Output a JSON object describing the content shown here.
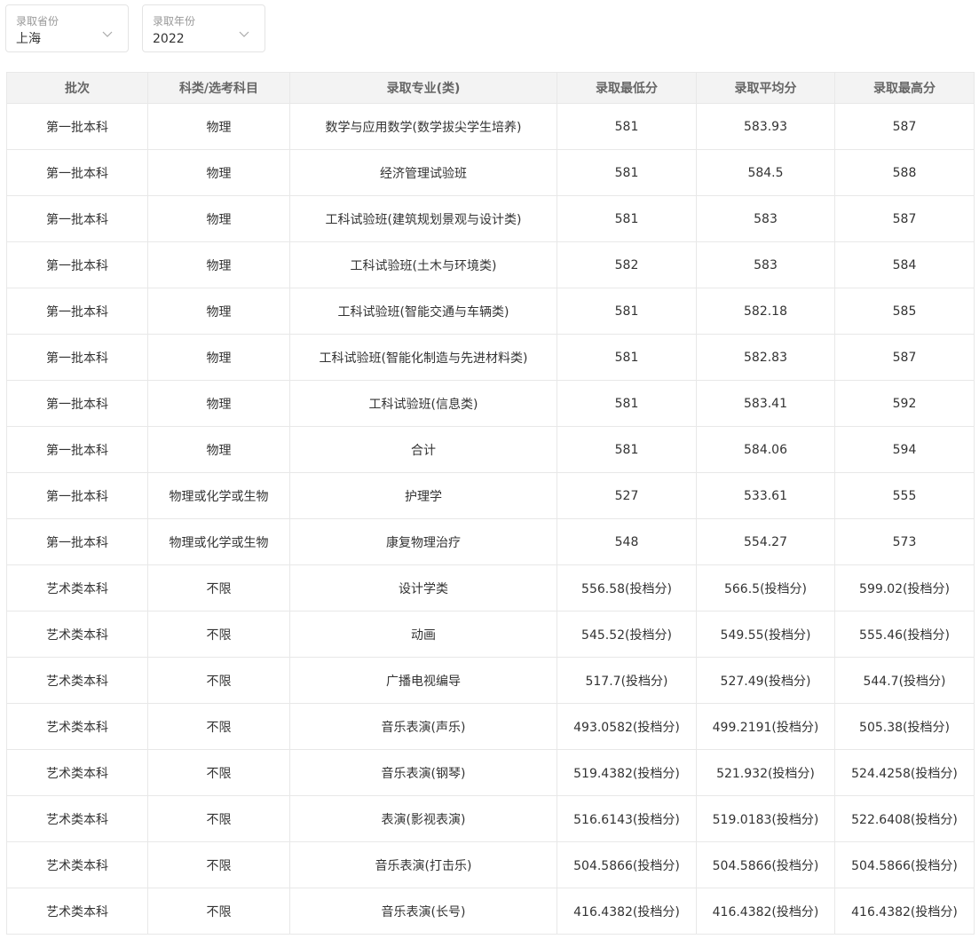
{
  "filters": {
    "province": {
      "label": "录取省份",
      "value": "上海"
    },
    "year": {
      "label": "录取年份",
      "value": "2022"
    }
  },
  "table": {
    "headers": [
      "批次",
      "科类/选考科目",
      "录取专业(类)",
      "录取最低分",
      "录取平均分",
      "录取最高分"
    ],
    "rows": [
      [
        "第一批本科",
        "物理",
        "数学与应用数学(数学拔尖学生培养)",
        "581",
        "583.93",
        "587"
      ],
      [
        "第一批本科",
        "物理",
        "经济管理试验班",
        "581",
        "584.5",
        "588"
      ],
      [
        "第一批本科",
        "物理",
        "工科试验班(建筑规划景观与设计类)",
        "581",
        "583",
        "587"
      ],
      [
        "第一批本科",
        "物理",
        "工科试验班(土木与环境类)",
        "582",
        "583",
        "584"
      ],
      [
        "第一批本科",
        "物理",
        "工科试验班(智能交通与车辆类)",
        "581",
        "582.18",
        "585"
      ],
      [
        "第一批本科",
        "物理",
        "工科试验班(智能化制造与先进材料类)",
        "581",
        "582.83",
        "587"
      ],
      [
        "第一批本科",
        "物理",
        "工科试验班(信息类)",
        "581",
        "583.41",
        "592"
      ],
      [
        "第一批本科",
        "物理",
        "合计",
        "581",
        "584.06",
        "594"
      ],
      [
        "第一批本科",
        "物理或化学或生物",
        "护理学",
        "527",
        "533.61",
        "555"
      ],
      [
        "第一批本科",
        "物理或化学或生物",
        "康复物理治疗",
        "548",
        "554.27",
        "573"
      ],
      [
        "艺术类本科",
        "不限",
        "设计学类",
        "556.58(投档分)",
        "566.5(投档分)",
        "599.02(投档分)"
      ],
      [
        "艺术类本科",
        "不限",
        "动画",
        "545.52(投档分)",
        "549.55(投档分)",
        "555.46(投档分)"
      ],
      [
        "艺术类本科",
        "不限",
        "广播电视编导",
        "517.7(投档分)",
        "527.49(投档分)",
        "544.7(投档分)"
      ],
      [
        "艺术类本科",
        "不限",
        "音乐表演(声乐)",
        "493.0582(投档分)",
        "499.2191(投档分)",
        "505.38(投档分)"
      ],
      [
        "艺术类本科",
        "不限",
        "音乐表演(钢琴)",
        "519.4382(投档分)",
        "521.932(投档分)",
        "524.4258(投档分)"
      ],
      [
        "艺术类本科",
        "不限",
        "表演(影视表演)",
        "516.6143(投档分)",
        "519.0183(投档分)",
        "522.6408(投档分)"
      ],
      [
        "艺术类本科",
        "不限",
        "音乐表演(打击乐)",
        "504.5866(投档分)",
        "504.5866(投档分)",
        "504.5866(投档分)"
      ],
      [
        "艺术类本科",
        "不限",
        "音乐表演(长号)",
        "416.4382(投档分)",
        "416.4382(投档分)",
        "416.4382(投档分)"
      ]
    ]
  },
  "icons": {
    "dropdown": "chevron-down-icon"
  },
  "colors": {
    "header_bg": "#f3f3f3",
    "border": "#e8e8e8",
    "text": "#333333",
    "muted": "#999999"
  }
}
